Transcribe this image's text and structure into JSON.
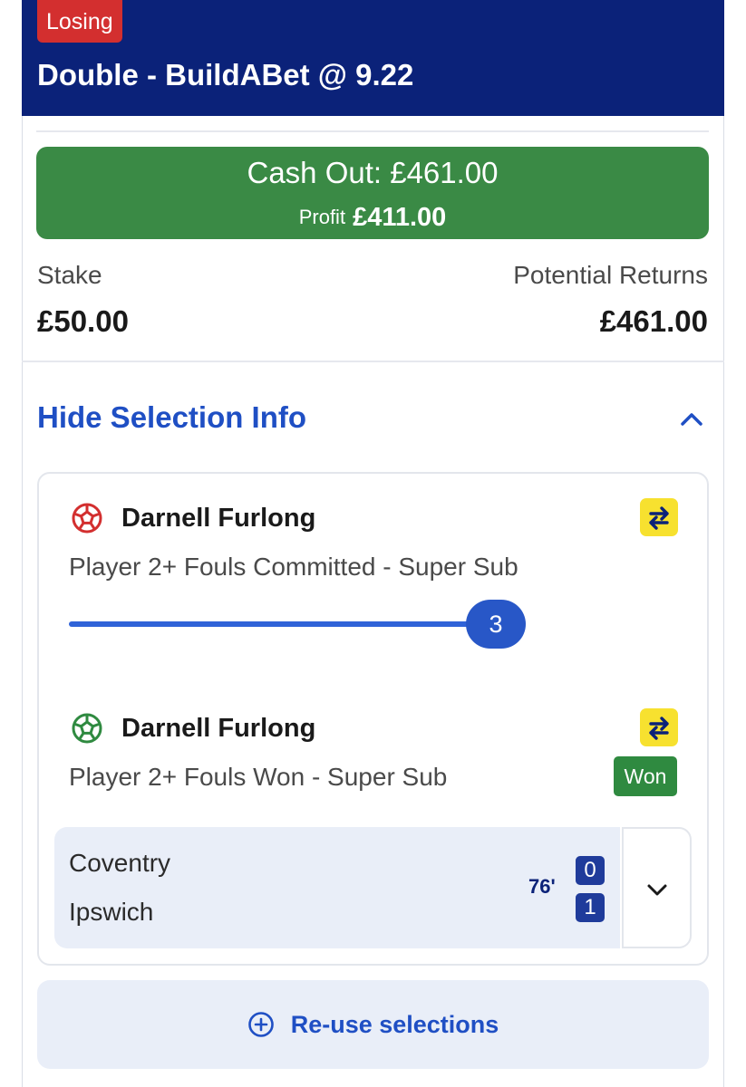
{
  "bet": {
    "status_badge": "Losing",
    "title": "Double - BuildABet @ 9.22"
  },
  "cash_out": {
    "label": "Cash Out: £461.00",
    "profit_label": "Profit",
    "profit_value": "£411.00"
  },
  "stake": {
    "label": "Stake",
    "value": "£50.00"
  },
  "returns": {
    "label": "Potential Returns",
    "value": "£461.00"
  },
  "selection_info": {
    "toggle_label": "Hide Selection Info"
  },
  "selections": [
    {
      "player": "Darnell Furlong",
      "market": "Player 2+ Fouls Committed - Super Sub",
      "progress_value": "3",
      "ball_color": "#d32f2f"
    },
    {
      "player": "Darnell Furlong",
      "market": "Player 2+ Fouls Won - Super Sub",
      "result": "Won",
      "ball_color": "#2f8a40"
    }
  ],
  "match": {
    "home": "Coventry",
    "away": "Ipswich",
    "time": "76'",
    "home_score": "0",
    "away_score": "1"
  },
  "actions": {
    "reuse_label": "Re-use selections"
  },
  "colors": {
    "header_bg": "#0b2279",
    "losing": "#d32f2f",
    "cashout_bg": "#3a8a45",
    "link_blue": "#1f4fc4",
    "swap_yellow": "#f7e12f"
  }
}
